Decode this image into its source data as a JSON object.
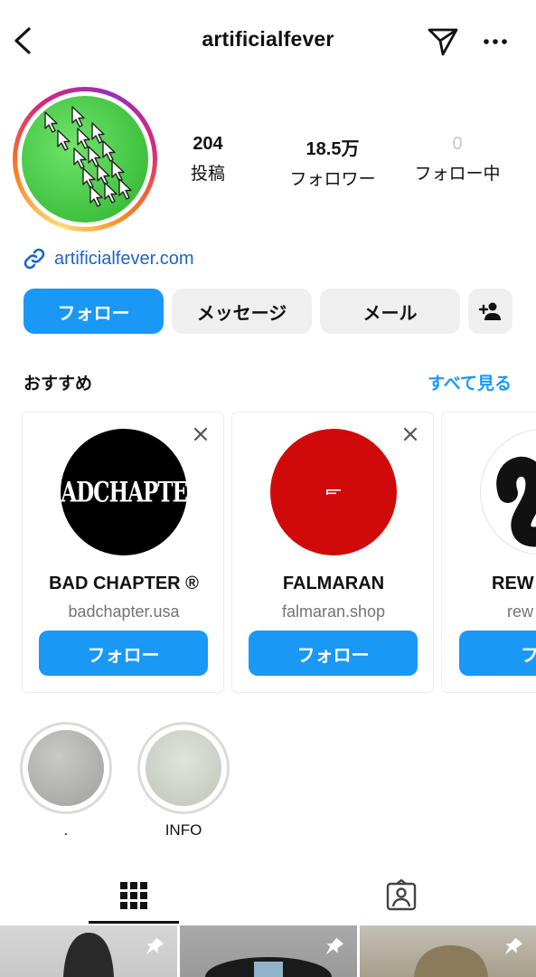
{
  "header": {
    "username": "artificialfever",
    "icons": {
      "back": "chevron-left-icon",
      "send": "paper-plane-icon",
      "more": "more-horizontal-icon"
    }
  },
  "profile": {
    "stats": [
      {
        "value": "204",
        "label": "投稿"
      },
      {
        "value": "18.5万",
        "label": "フォロワー"
      },
      {
        "value": "0",
        "label": "フォロー中"
      }
    ],
    "link": "artificialfever.com"
  },
  "actions": {
    "follow": "フォロー",
    "message": "メッセージ",
    "mail": "メール",
    "add_user_icon": "add-person-icon"
  },
  "suggestions": {
    "title": "おすすめ",
    "see_all": "すべて見る",
    "cards": [
      {
        "logo_text": "BADCHAPTER",
        "name": "BAD CHAPTER ®",
        "sub": "badchapter.usa",
        "button": "フォロー"
      },
      {
        "name": "FALMARAN",
        "sub": "falmaran.shop",
        "button": "フォロー"
      },
      {
        "name": "REW",
        "sub": "rew",
        "button": "フォ"
      }
    ]
  },
  "highlights": [
    {
      "label": "."
    },
    {
      "label": "INFO"
    }
  ],
  "tabs": [
    {
      "icon": "grid-icon",
      "active": true
    },
    {
      "icon": "tagged-person-icon",
      "active": false
    }
  ],
  "colors": {
    "accent": "#1a98f6",
    "link": "#1d64c8",
    "button_secondary": "#efefef",
    "muted_text": "#737373",
    "falmaran_red": "#d00a0a"
  }
}
